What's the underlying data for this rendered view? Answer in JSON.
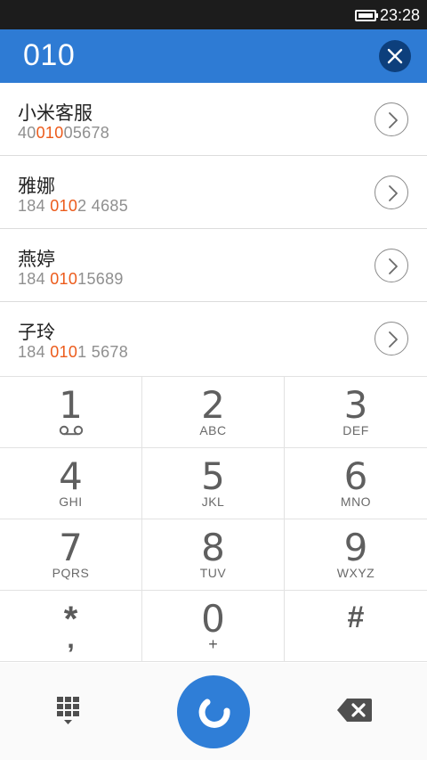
{
  "status_bar": {
    "time": "23:28"
  },
  "header": {
    "dialed_number": "010"
  },
  "contacts": [
    {
      "name": "小米客服",
      "number_pre": "40",
      "number_match": "010",
      "number_post": "05678"
    },
    {
      "name": "雅娜",
      "number_pre": "184 ",
      "number_match": "010",
      "number_post": "2 4685"
    },
    {
      "name": "燕婷",
      "number_pre": "184 ",
      "number_match": "010",
      "number_post": "15689"
    },
    {
      "name": "子玲",
      "number_pre": "184 ",
      "number_match": "010",
      "number_post": "1 5678"
    }
  ],
  "keypad": {
    "k1": {
      "digit": "1",
      "sub": ""
    },
    "k2": {
      "digit": "2",
      "sub": "ABC"
    },
    "k3": {
      "digit": "3",
      "sub": "DEF"
    },
    "k4": {
      "digit": "4",
      "sub": "GHI"
    },
    "k5": {
      "digit": "5",
      "sub": "JKL"
    },
    "k6": {
      "digit": "6",
      "sub": "MNO"
    },
    "k7": {
      "digit": "7",
      "sub": "PQRS"
    },
    "k8": {
      "digit": "8",
      "sub": "TUV"
    },
    "k9": {
      "digit": "9",
      "sub": "WXYZ"
    },
    "kstar": {
      "digit": "*",
      "sub": ","
    },
    "k0": {
      "digit": "0",
      "sub": "+"
    },
    "khash": {
      "digit": "#",
      "sub": ""
    }
  },
  "icons": {
    "battery": "battery-icon",
    "clear": "close-icon",
    "detail": "chevron-right-icon",
    "voicemail": "voicemail-icon",
    "dialpad": "dialpad-icon",
    "call": "phone-icon",
    "delete": "backspace-icon"
  },
  "colors": {
    "header_bg": "#2e7bd4",
    "clear_button_bg": "#0d3f7c",
    "match_highlight": "#ec5b1b",
    "call_button_bg": "#2f7ed7",
    "status_bar_bg": "#1c1c1c"
  }
}
